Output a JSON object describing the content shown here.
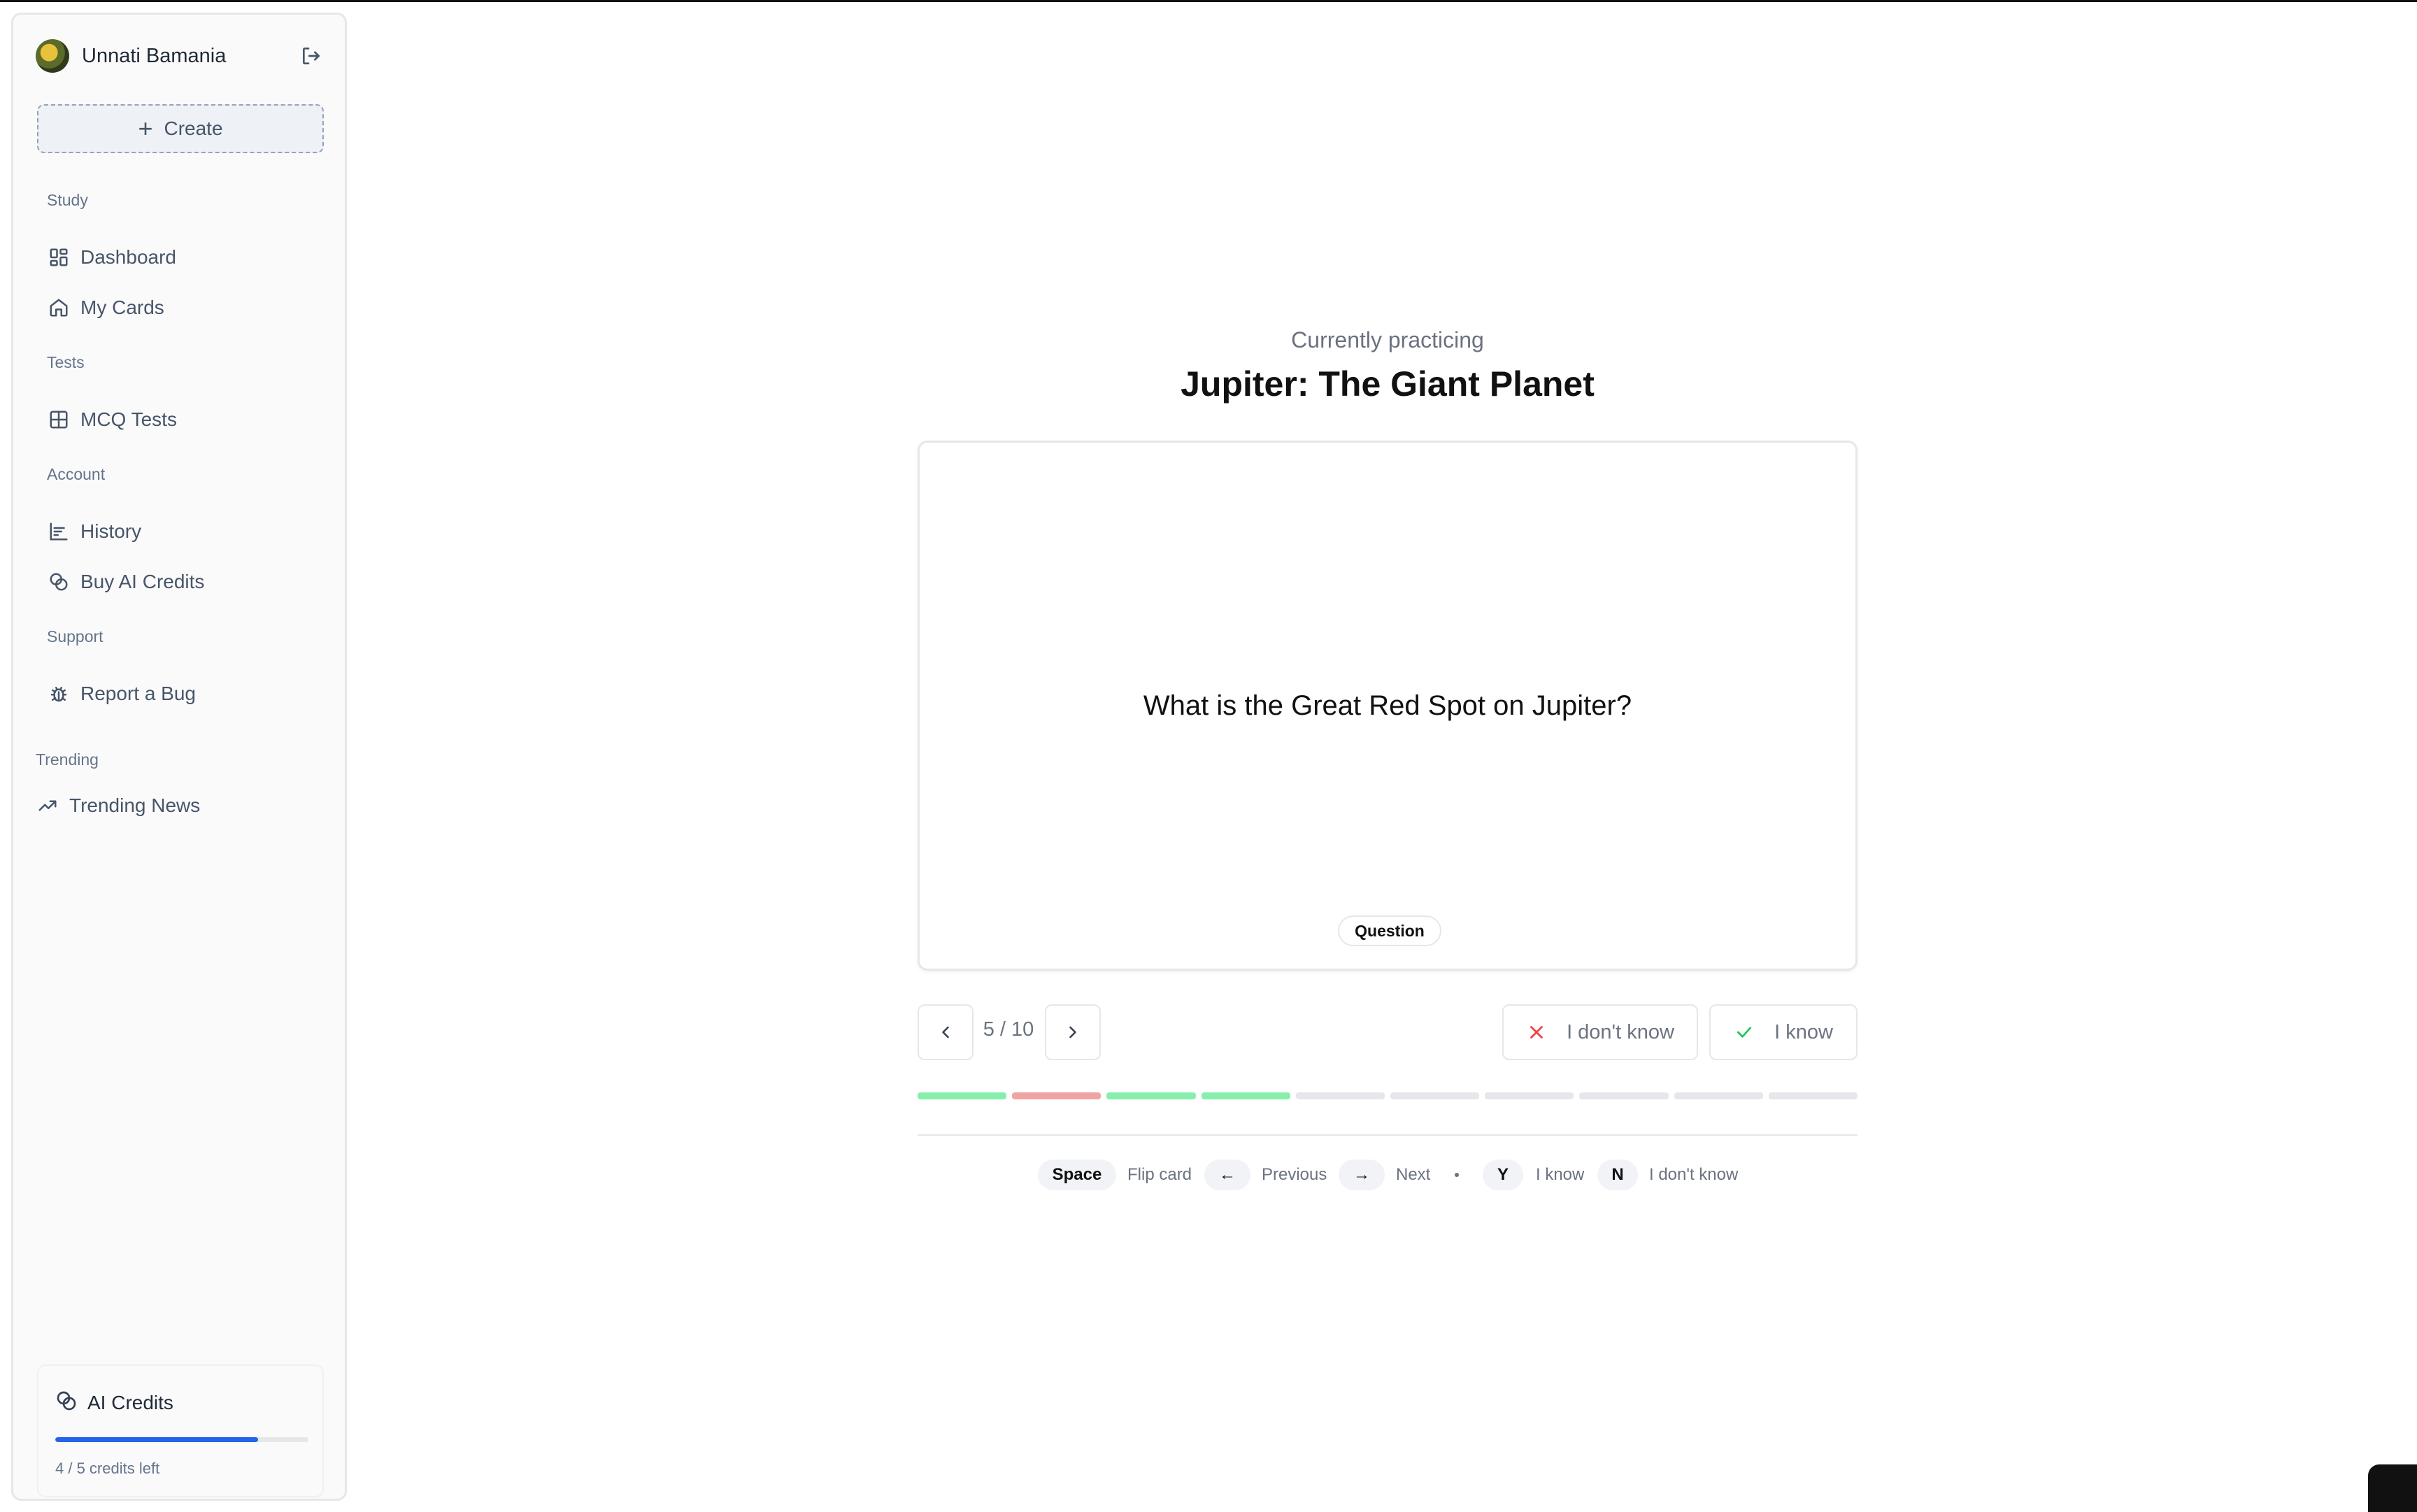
{
  "user": {
    "name": "Unnati Bamania"
  },
  "sidebar": {
    "create_label": "Create",
    "sections": {
      "study": "Study",
      "tests": "Tests",
      "account": "Account",
      "support": "Support",
      "trending": "Trending"
    },
    "items": {
      "dashboard": "Dashboard",
      "my_cards": "My Cards",
      "mcq_tests": "MCQ Tests",
      "history": "History",
      "buy_ai_credits": "Buy AI Credits",
      "report_bug": "Report a Bug",
      "trending_news": "Trending News"
    },
    "credits": {
      "title": "AI Credits",
      "used": 4,
      "total": 5,
      "fraction": 0.8,
      "left_text": "4 / 5 credits left",
      "bar_color": "#2563eb"
    }
  },
  "main": {
    "subtitle": "Currently practicing",
    "title": "Jupiter: The Giant Planet",
    "card": {
      "question": "What is the Great Red Spot on Jupiter?",
      "side_badge": "Question"
    },
    "counter": "5 / 10",
    "dont_know_label": "I don't know",
    "know_label": "I know",
    "progress": {
      "current": 5,
      "total": 10,
      "segments": [
        "known",
        "unknown",
        "known",
        "known",
        "pending",
        "pending",
        "pending",
        "pending",
        "pending",
        "pending"
      ],
      "colors": {
        "known": "#86efac",
        "unknown": "#f0a3a3",
        "pending": "#e5e7eb"
      }
    },
    "shortcuts": {
      "space_key": "Space",
      "space_hint": "Flip card",
      "left_key": "←",
      "left_hint": "Previous",
      "right_key": "→",
      "right_hint": "Next",
      "y_key": "Y",
      "y_hint": "I know",
      "n_key": "N",
      "n_hint": "I don't know"
    }
  },
  "icons": {
    "logout": "logout-icon",
    "dashboard": "layout-grid-icon",
    "my_cards": "home-icon",
    "mcq": "table-icon",
    "history": "bar-chart-icon",
    "credits": "coins-icon",
    "bug": "bug-icon",
    "trending": "trending-up-icon",
    "prev": "chevron-left-icon",
    "next": "chevron-right-icon",
    "x": "x-icon",
    "check": "check-icon"
  },
  "colors": {
    "accent": "#2563eb",
    "danger": "#ef4444",
    "success": "#22c55e"
  }
}
